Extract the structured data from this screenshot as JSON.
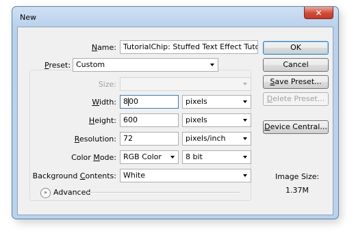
{
  "window": {
    "title": "New",
    "close_glyph": "✕"
  },
  "form": {
    "name": {
      "label": "Name:",
      "value": "TutorialChip: Stuffed Text Effect Tutorial"
    },
    "preset": {
      "label": "Preset:",
      "value": "Custom"
    },
    "size": {
      "label": "Size:",
      "value": ""
    },
    "width": {
      "label": "Width:",
      "value_before_cursor": "8",
      "value_after_cursor": "00",
      "unit": "pixels"
    },
    "height": {
      "label": "Height:",
      "value": "600",
      "unit": "pixels"
    },
    "resolution": {
      "label": "Resolution:",
      "value": "72",
      "unit": "pixels/inch"
    },
    "color_mode": {
      "label": "Color Mode:",
      "value": "RGB Color",
      "depth": "8 bit"
    },
    "background_contents": {
      "label": "Background Contents:",
      "value": "White"
    },
    "advanced": {
      "label": "Advanced",
      "icon": "chevron-double-down-icon"
    }
  },
  "buttons": {
    "ok": "OK",
    "cancel": "Cancel",
    "save_preset": "Save Preset...",
    "delete_preset": "Delete Preset...",
    "device_central": "Device Central..."
  },
  "image_size": {
    "label": "Image Size:",
    "value": "1.37M"
  },
  "colors": {
    "accent": "#3c7fb1",
    "close": "#c23b28",
    "frame": "#bad2ed"
  }
}
